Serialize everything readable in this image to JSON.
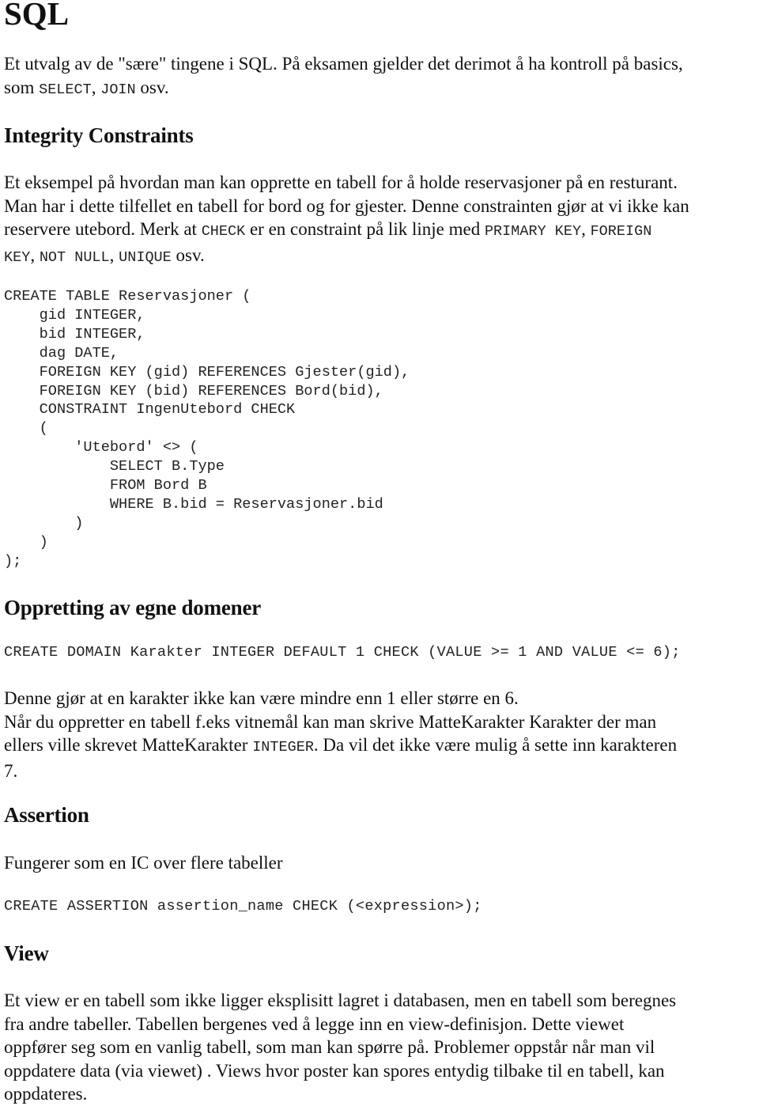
{
  "title": "SQL",
  "intro": {
    "line1": "Et utvalg av de \"sære\" tingene i SQL. På eksamen gjelder det derimot å ha kontroll på basics,",
    "line2_pre": "som ",
    "line2_code1": "SELECT",
    "line2_sep": ", ",
    "line2_code2": "JOIN",
    "line2_post": " osv."
  },
  "integrity": {
    "heading": "Integrity Constraints",
    "line1": "Et eksempel på hvordan man kan opprette en tabell for å holde reservasjoner på en resturant.",
    "line2": "Man har i dette tilfellet en tabell for bord og for gjester. Denne constrainten gjør at vi ikke kan",
    "line3_pre": "reservere utebord. Merk at ",
    "line3_code1": "CHECK",
    "line3_mid": " er en constraint på lik linje med ",
    "line3_code2": "PRIMARY KEY",
    "line3_sep": ", ",
    "line3_code3": "FOREIGN",
    "line4_code1": "KEY",
    "line4_sep1": ", ",
    "line4_code2": "NOT NULL",
    "line4_sep2": ", ",
    "line4_code3": "UNIQUE",
    "line4_post": " osv.",
    "code": "CREATE TABLE Reservasjoner (\n    gid INTEGER,\n    bid INTEGER,\n    dag DATE,\n    FOREIGN KEY (gid) REFERENCES Gjester(gid),\n    FOREIGN KEY (bid) REFERENCES Bord(bid),\n    CONSTRAINT IngenUtebord CHECK\n    (\n        'Utebord' <> (\n            SELECT B.Type\n            FROM Bord B\n            WHERE B.bid = Reservasjoner.bid\n        )\n    )\n);"
  },
  "domains": {
    "heading": "Oppretting av egne domener",
    "code": "CREATE DOMAIN Karakter INTEGER DEFAULT 1 CHECK (VALUE >= 1 AND VALUE <= 6);",
    "line1": "Denne gjør at en karakter ikke kan være mindre enn 1 eller større en 6.",
    "line2": "Når du oppretter en tabell f.eks vitnemål kan man skrive MatteKarakter Karakter der man",
    "line3_pre": "ellers ville skrevet MatteKarakter ",
    "line3_code": "INTEGER",
    "line3_post": ". Da vil det ikke være mulig å sette inn karakteren",
    "line4": "7."
  },
  "assertion": {
    "heading": "Assertion",
    "text": "Fungerer som en IC over flere tabeller",
    "code": "CREATE ASSERTION assertion_name CHECK (<expression>);"
  },
  "view": {
    "heading": "View",
    "lines": [
      "Et view er en tabell som ikke ligger eksplisitt lagret i databasen, men en tabell som beregnes",
      "fra andre tabeller. Tabellen bergenes ved å legge inn en view-definisjon. Dette viewet",
      "oppfører seg som en vanlig tabell, som man kan spørre på. Problemer oppstår når man vil",
      "oppdatere data (via viewet) . Views hvor poster kan spores entydig tilbake til en tabell, kan",
      "oppdateres."
    ]
  }
}
